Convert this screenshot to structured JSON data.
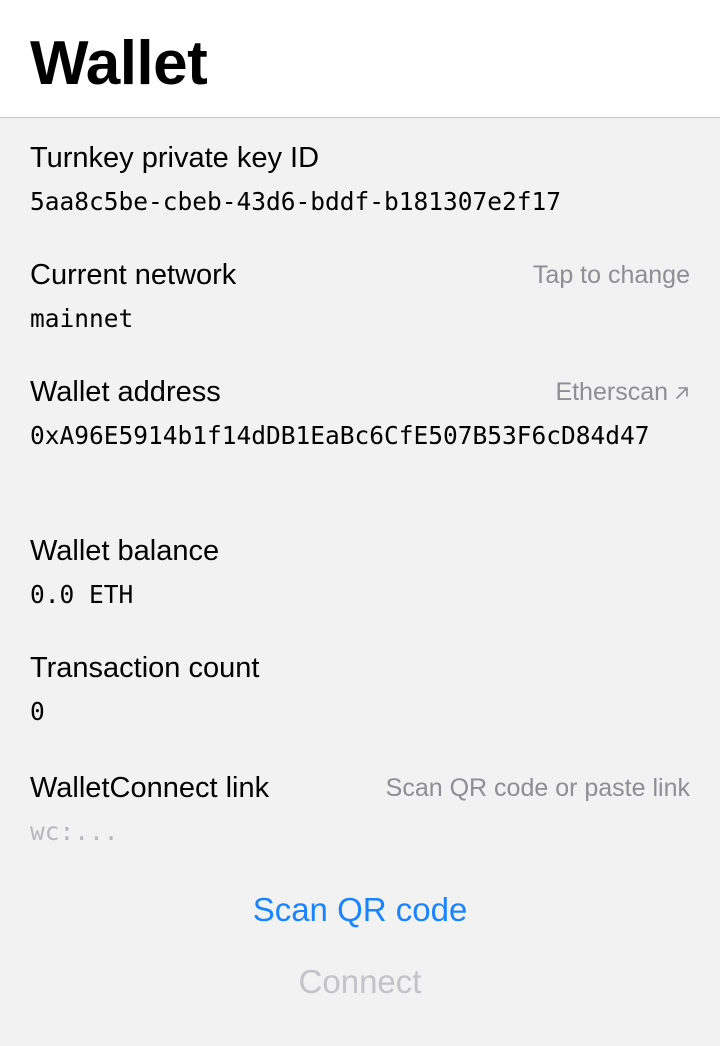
{
  "header": {
    "title": "Wallet"
  },
  "private_key": {
    "label": "Turnkey private key ID",
    "value": "5aa8c5be-cbeb-43d6-bddf-b181307e2f17"
  },
  "network": {
    "label": "Current network",
    "hint": "Tap to change",
    "value": "mainnet"
  },
  "address": {
    "label": "Wallet address",
    "link": "Etherscan",
    "link_icon": "external-link-arrow-icon",
    "value": "0xA96E5914b1f14dDB1EaBc6CfE507B53F6cD84d47"
  },
  "balance": {
    "label": "Wallet balance",
    "value": "0.0 ETH"
  },
  "tx_count": {
    "label": "Transaction count",
    "value": "0"
  },
  "walletconnect": {
    "label": "WalletConnect link",
    "hint": "Scan QR code or paste link",
    "placeholder": "wc:..."
  },
  "actions": {
    "scan_label": "Scan QR code",
    "connect_label": "Connect"
  },
  "colors": {
    "accent": "#1a84ff",
    "secondary_text": "#8e8e93",
    "background": "#f2f2f2"
  }
}
